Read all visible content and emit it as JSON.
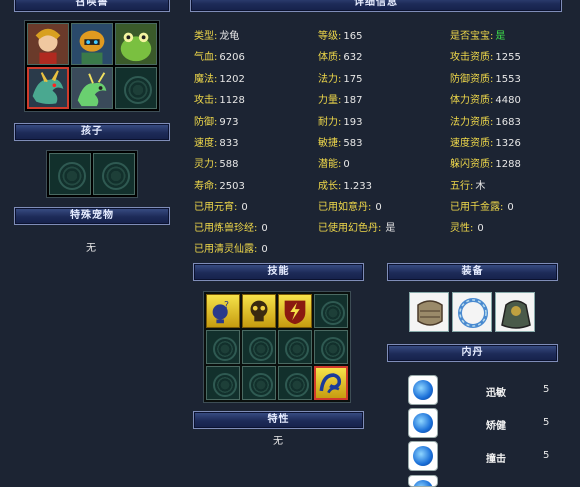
{
  "headers": {
    "summon": "召唤兽",
    "details": "详细信息",
    "children": "孩子",
    "special_pet": "特殊宠物",
    "skills": "技能",
    "equipment": "装备",
    "neidan": "内丹",
    "traits": "特性"
  },
  "special_pet_value": "无",
  "traits_value": "无",
  "stats": {
    "col1": [
      {
        "label": "类型:",
        "value": "龙龟"
      },
      {
        "label": "气血:",
        "value": "6206"
      },
      {
        "label": "魔法:",
        "value": "1202"
      },
      {
        "label": "攻击:",
        "value": "1128"
      },
      {
        "label": "防御:",
        "value": "973"
      },
      {
        "label": "速度:",
        "value": "833"
      },
      {
        "label": "灵力:",
        "value": "588"
      },
      {
        "label": "寿命:",
        "value": "2503"
      }
    ],
    "col2": [
      {
        "label": "等级:",
        "value": "165"
      },
      {
        "label": "体质:",
        "value": "632"
      },
      {
        "label": "法力:",
        "value": "175"
      },
      {
        "label": "力量:",
        "value": "187"
      },
      {
        "label": "耐力:",
        "value": "193"
      },
      {
        "label": "敏捷:",
        "value": "583"
      },
      {
        "label": "潜能:",
        "value": "0"
      },
      {
        "label": "成长:",
        "value": "1.233"
      }
    ],
    "col3": [
      {
        "label": "是否宝宝:",
        "value": "是"
      },
      {
        "label": "攻击资质:",
        "value": "1255"
      },
      {
        "label": "防御资质:",
        "value": "1553"
      },
      {
        "label": "体力资质:",
        "value": "4480"
      },
      {
        "label": "法力资质:",
        "value": "1683"
      },
      {
        "label": "速度资质:",
        "value": "1326"
      },
      {
        "label": "躲闪资质:",
        "value": "1288"
      },
      {
        "label": "五行:",
        "value": "木"
      }
    ],
    "extra": [
      {
        "label": "已用元宵:",
        "value": "0"
      },
      {
        "label": "已用如意丹:",
        "value": "0"
      },
      {
        "label": "已用千金露:",
        "value": "0"
      },
      {
        "label": "已用炼兽珍经:",
        "value": "0"
      },
      {
        "label": "已使用幻色丹:",
        "value": "是"
      },
      {
        "label": "灵性:",
        "value": "0"
      },
      {
        "label": "已用清灵仙露:",
        "value": "0"
      }
    ]
  },
  "neidan": [
    {
      "name": "迅敏",
      "level": "5"
    },
    {
      "name": "矫健",
      "level": "5"
    },
    {
      "name": "撞击",
      "level": "5"
    }
  ],
  "colors": {
    "label": "#f0d94a",
    "value": "#e8e8e8",
    "highlight": "#3ee04a",
    "selected_border": "#d03b2c"
  }
}
